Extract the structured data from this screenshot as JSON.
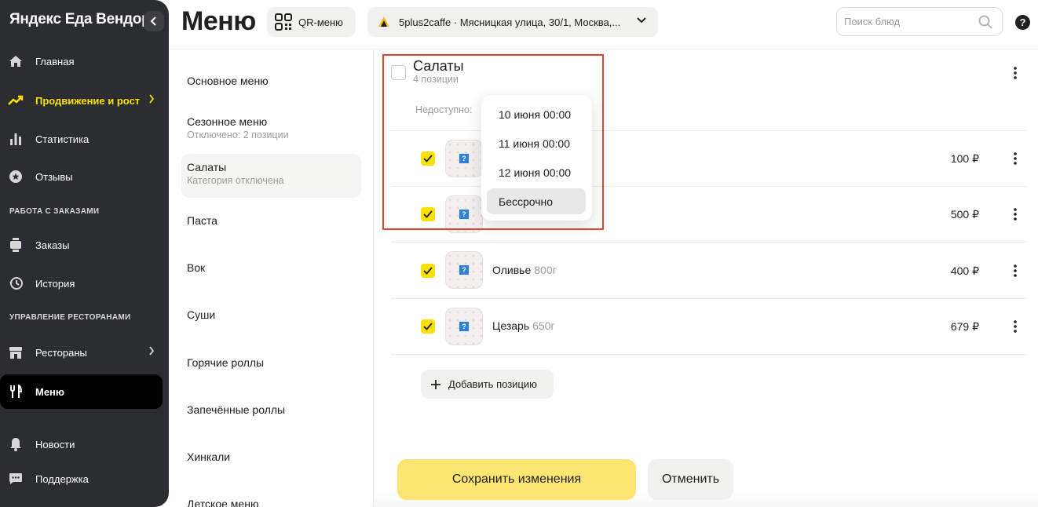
{
  "sidebar": {
    "brand": "Яндекс Еда Вендор",
    "items": [
      {
        "label": "Главная",
        "icon": "home-icon"
      },
      {
        "label": "Продвижение и рост",
        "icon": "trend-up-icon"
      },
      {
        "label": "Статистика",
        "icon": "bar-chart-icon"
      },
      {
        "label": "Отзывы",
        "icon": "star-chat-icon"
      },
      {
        "label": "Заказы",
        "icon": "order-icon"
      },
      {
        "label": "История",
        "icon": "history-icon"
      },
      {
        "label": "Рестораны",
        "icon": "store-icon"
      },
      {
        "label": "Меню",
        "icon": "fork-knife-icon"
      },
      {
        "label": "Новости",
        "icon": "bell-icon"
      },
      {
        "label": "Поддержка",
        "icon": "chat-icon"
      }
    ],
    "sections": {
      "orders": "РАБОТА С ЗАКАЗАМИ",
      "restaurants": "УПРАВЛЕНИЕ РЕСТОРАНАМИ"
    }
  },
  "header": {
    "title": "Меню",
    "qr_label": "QR-меню",
    "restaurant": "5plus2caffe · Мясницкая улица, 30/1, Москва,...",
    "search_placeholder": "Поиск блюд",
    "help": "?"
  },
  "categories": [
    {
      "name": "Основное меню",
      "sub": ""
    },
    {
      "name": "Сезонное меню",
      "sub": "Отключено: 2 позиции"
    },
    {
      "name": "Салаты",
      "sub": "Категория отключена"
    },
    {
      "name": "Паста",
      "sub": ""
    },
    {
      "name": "Вок",
      "sub": ""
    },
    {
      "name": "Суши",
      "sub": ""
    },
    {
      "name": "Горячие роллы",
      "sub": ""
    },
    {
      "name": "Запечённые роллы",
      "sub": ""
    },
    {
      "name": "Хинкали",
      "sub": ""
    },
    {
      "name": "Детское меню",
      "sub": ""
    }
  ],
  "main": {
    "category_title": "Салаты",
    "category_count": "4 позиции",
    "unavailable_label": "Недоступно:",
    "items": [
      {
        "name": "",
        "weight": "",
        "price": "100 ₽"
      },
      {
        "name": "",
        "weight": "",
        "price": "500 ₽"
      },
      {
        "name": "Оливье",
        "weight": "800г",
        "price": "400 ₽"
      },
      {
        "name": "Цезарь",
        "weight": "650г",
        "price": "679 ₽"
      }
    ],
    "add_label": "Добавить позицию"
  },
  "dropdown": {
    "options": [
      "10 июня 00:00",
      "11 июня 00:00",
      "12 июня 00:00",
      "Бессрочно"
    ]
  },
  "footer": {
    "save_label": "Сохранить изменения",
    "cancel_label": "Отменить"
  },
  "colors": {
    "sidebar_bg": "#2b2d31",
    "accent_yellow": "#fce000",
    "save_yellow": "#fce570",
    "highlight_red": "#e0452e"
  }
}
